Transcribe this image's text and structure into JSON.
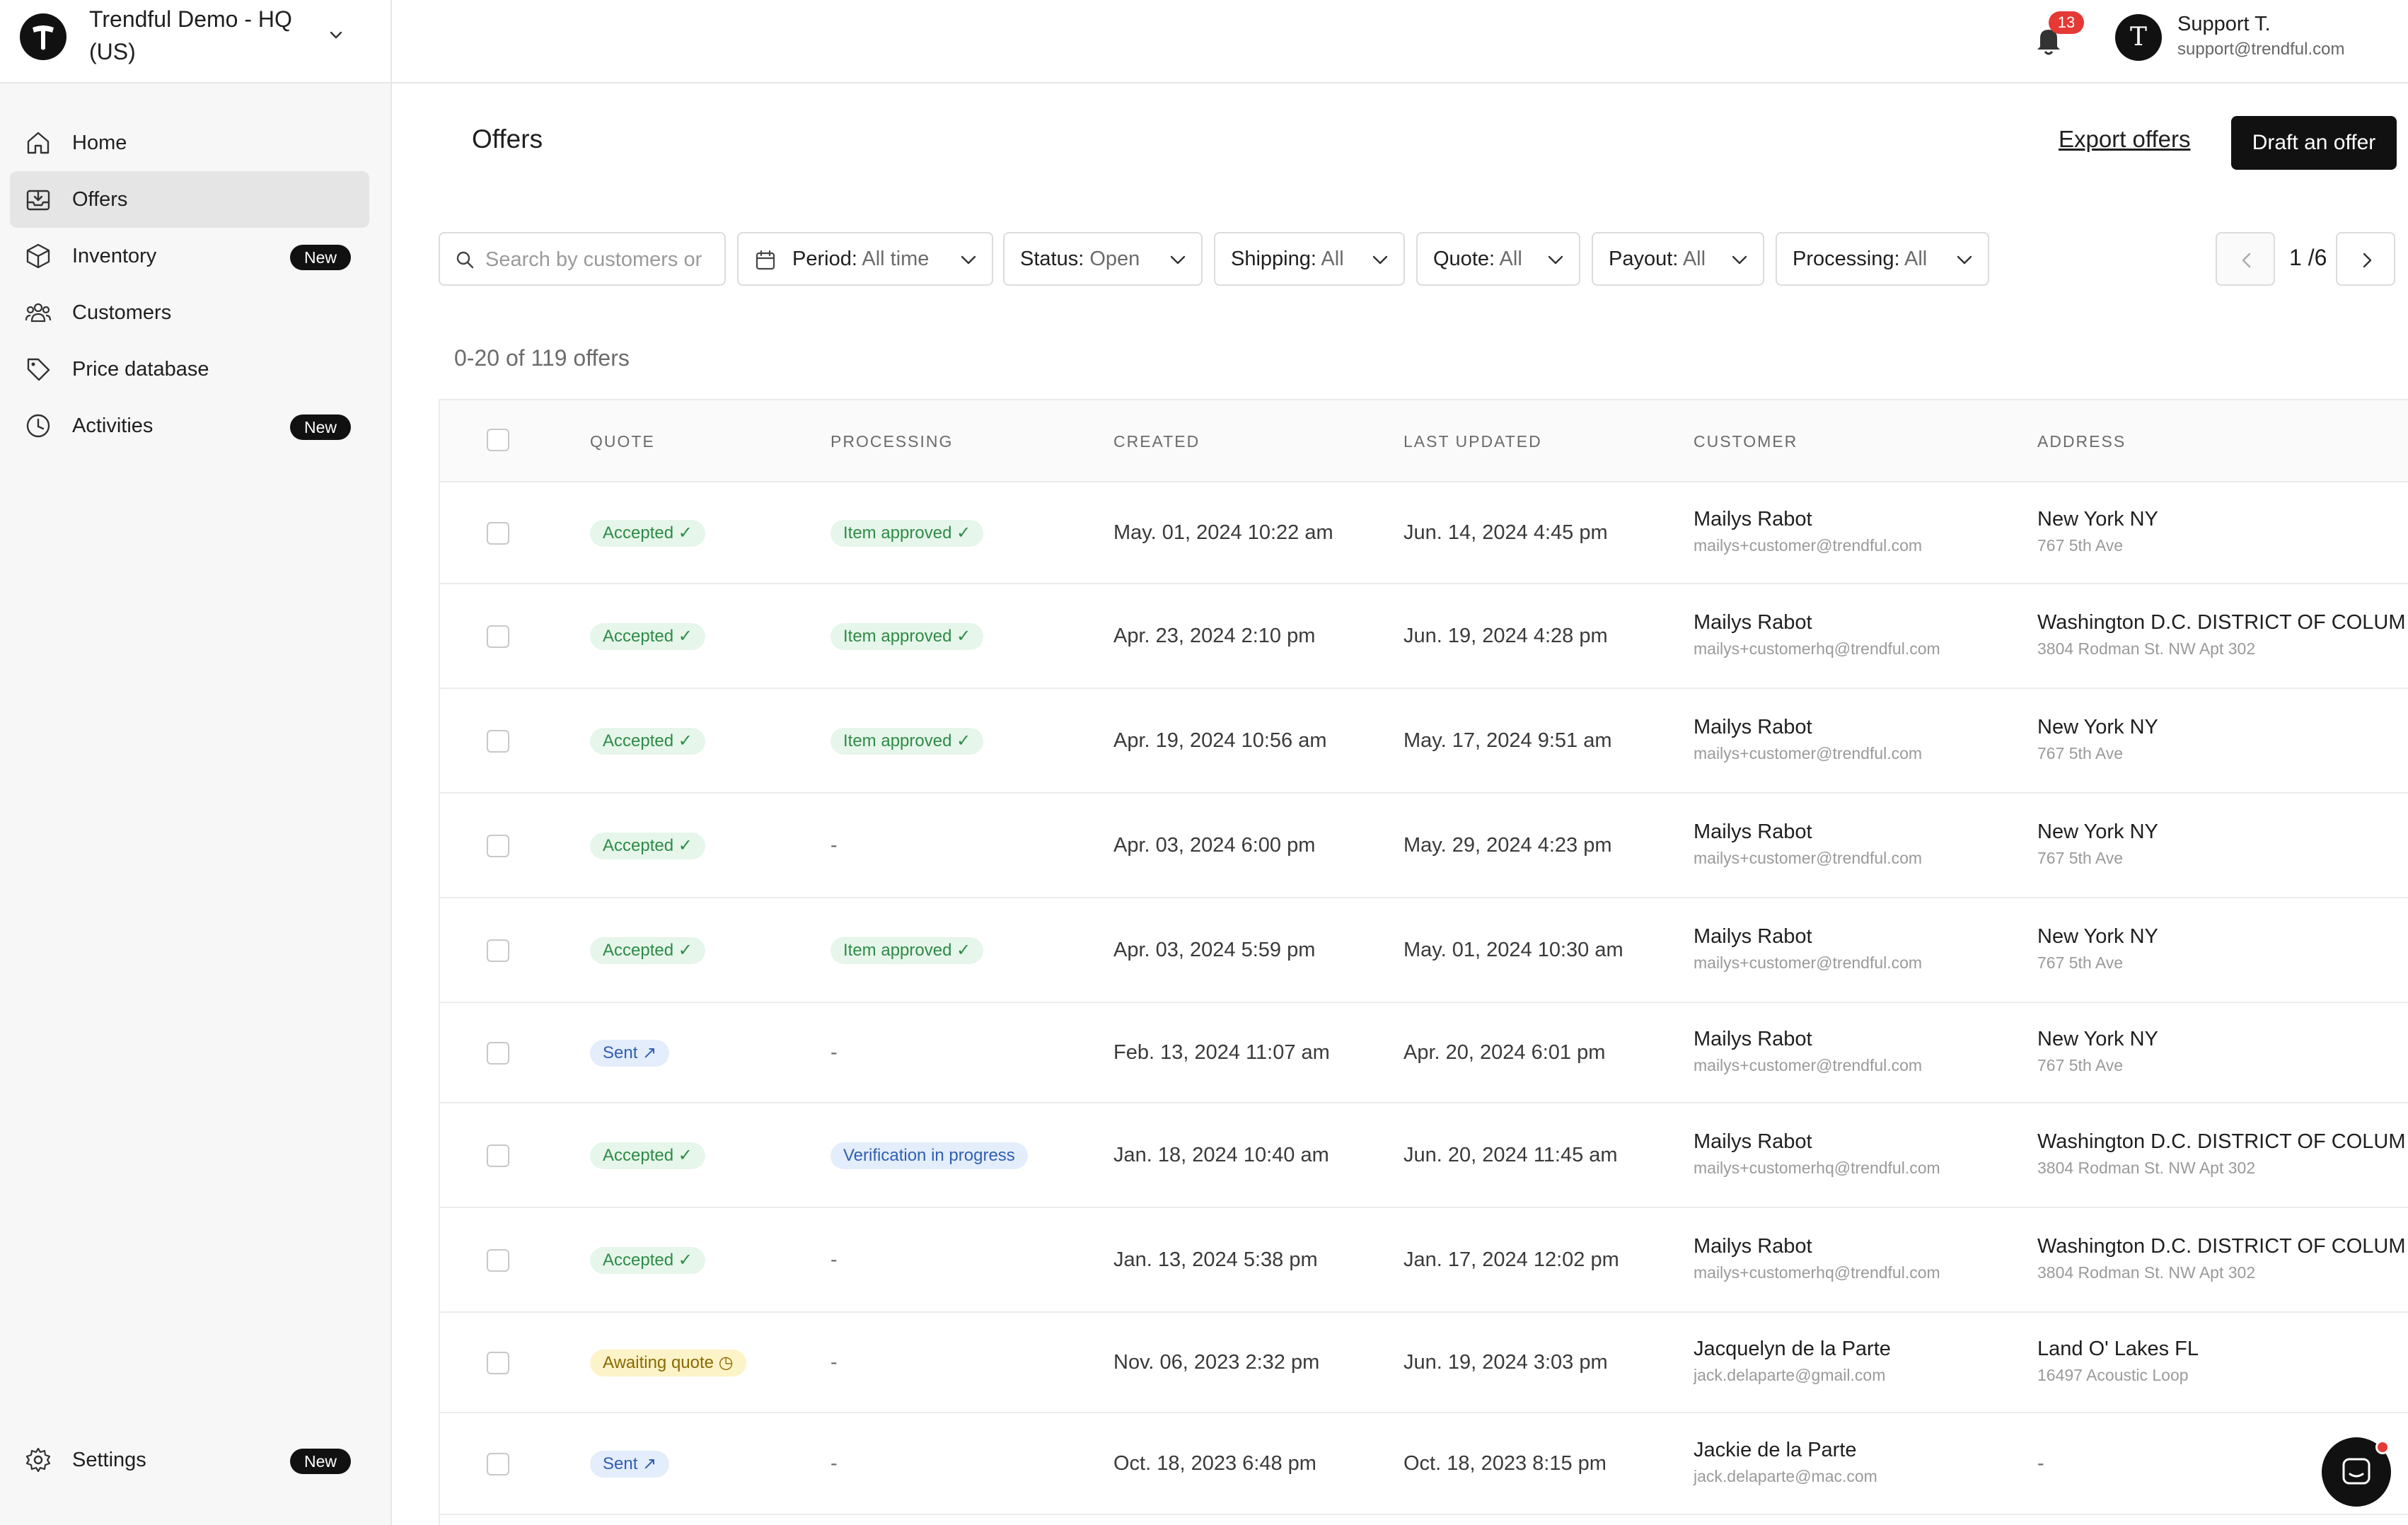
{
  "org": {
    "name": "Trendful Demo - HQ (US)"
  },
  "nav": {
    "items": [
      {
        "label": "Home",
        "icon": "home-icon",
        "badge": "",
        "active": false
      },
      {
        "label": "Offers",
        "icon": "inbox-icon",
        "badge": "",
        "active": true
      },
      {
        "label": "Inventory",
        "icon": "box-icon",
        "badge": "New",
        "active": false
      },
      {
        "label": "Customers",
        "icon": "users-icon",
        "badge": "",
        "active": false
      },
      {
        "label": "Price database",
        "icon": "tag-icon",
        "badge": "",
        "active": false
      },
      {
        "label": "Activities",
        "icon": "clock-icon",
        "badge": "New",
        "active": false
      }
    ],
    "settings": {
      "label": "Settings",
      "badge": "New",
      "icon": "gear-icon"
    }
  },
  "topbar": {
    "notifications_count": "13",
    "user": {
      "initial": "T",
      "name": "Support T.",
      "email": "support@trendful.com"
    }
  },
  "page": {
    "title": "Offers",
    "export_label": "Export offers",
    "draft_label": "Draft an offer"
  },
  "filters": {
    "search_placeholder": "Search by customers or",
    "period": {
      "label": "Period:",
      "value": "All time"
    },
    "status": {
      "label": "Status:",
      "value": "Open"
    },
    "shipping": {
      "label": "Shipping:",
      "value": "All"
    },
    "quote": {
      "label": "Quote:",
      "value": "All"
    },
    "payout": {
      "label": "Payout:",
      "value": "All"
    },
    "processing": {
      "label": "Processing:",
      "value": "All"
    }
  },
  "pager": {
    "text": "1 /6"
  },
  "count_text": "0-20 of 119 offers",
  "table": {
    "columns": [
      "QUOTE",
      "PROCESSING",
      "CREATED",
      "LAST UPDATED",
      "CUSTOMER",
      "ADDRESS"
    ],
    "rows": [
      {
        "quote": "Accepted ✓",
        "quote_color": "green",
        "processing": "Item approved ✓",
        "processing_color": "green",
        "created": "May. 01, 2024 10:22 am",
        "updated": "Jun. 14, 2024 4:45 pm",
        "customer_name": "Mailys Rabot",
        "customer_email": "mailys+customer@trendful.com",
        "address_city": "New York NY",
        "address_street": "767 5th Ave"
      },
      {
        "quote": "Accepted ✓",
        "quote_color": "green",
        "processing": "Item approved ✓",
        "processing_color": "green",
        "created": "Apr. 23, 2024 2:10 pm",
        "updated": "Jun. 19, 2024 4:28 pm",
        "customer_name": "Mailys Rabot",
        "customer_email": "mailys+customerhq@trendful.com",
        "address_city": "Washington D.C. DISTRICT OF COLUM",
        "address_street": "3804 Rodman St. NW Apt 302"
      },
      {
        "quote": "Accepted ✓",
        "quote_color": "green",
        "processing": "Item approved ✓",
        "processing_color": "green",
        "created": "Apr. 19, 2024 10:56 am",
        "updated": "May. 17, 2024 9:51 am",
        "customer_name": "Mailys Rabot",
        "customer_email": "mailys+customer@trendful.com",
        "address_city": "New York NY",
        "address_street": "767 5th Ave"
      },
      {
        "quote": "Accepted ✓",
        "quote_color": "green",
        "processing": "-",
        "processing_color": "",
        "created": "Apr. 03, 2024 6:00 pm",
        "updated": "May. 29, 2024 4:23 pm",
        "customer_name": "Mailys Rabot",
        "customer_email": "mailys+customer@trendful.com",
        "address_city": "New York NY",
        "address_street": "767 5th Ave"
      },
      {
        "quote": "Accepted ✓",
        "quote_color": "green",
        "processing": "Item approved ✓",
        "processing_color": "green",
        "created": "Apr. 03, 2024 5:59 pm",
        "updated": "May. 01, 2024 10:30 am",
        "customer_name": "Mailys Rabot",
        "customer_email": "mailys+customer@trendful.com",
        "address_city": "New York NY",
        "address_street": "767 5th Ave"
      },
      {
        "quote": "Sent ↗",
        "quote_color": "blue",
        "processing": "-",
        "processing_color": "",
        "created": "Feb. 13, 2024 11:07 am",
        "updated": "Apr. 20, 2024 6:01 pm",
        "customer_name": "Mailys Rabot",
        "customer_email": "mailys+customer@trendful.com",
        "address_city": "New York NY",
        "address_street": "767 5th Ave"
      },
      {
        "quote": "Accepted ✓",
        "quote_color": "green",
        "processing": "Verification in progress",
        "processing_color": "blue",
        "created": "Jan. 18, 2024 10:40 am",
        "updated": "Jun. 20, 2024 11:45 am",
        "customer_name": "Mailys Rabot",
        "customer_email": "mailys+customerhq@trendful.com",
        "address_city": "Washington D.C. DISTRICT OF COLUM",
        "address_street": "3804 Rodman St. NW Apt 302"
      },
      {
        "quote": "Accepted ✓",
        "quote_color": "green",
        "processing": "-",
        "processing_color": "",
        "created": "Jan. 13, 2024 5:38 pm",
        "updated": "Jan. 17, 2024 12:02 pm",
        "customer_name": "Mailys Rabot",
        "customer_email": "mailys+customerhq@trendful.com",
        "address_city": "Washington D.C. DISTRICT OF COLUM",
        "address_street": "3804 Rodman St. NW Apt 302"
      },
      {
        "quote": "Awaiting quote ◷",
        "quote_color": "yellow",
        "processing": "-",
        "processing_color": "",
        "created": "Nov. 06, 2023 2:32 pm",
        "updated": "Jun. 19, 2024 3:03 pm",
        "customer_name": "Jacquelyn de la Parte",
        "customer_email": "jack.delaparte@gmail.com",
        "address_city": "Land O' Lakes FL",
        "address_street": "16497 Acoustic Loop"
      },
      {
        "quote": "Sent ↗",
        "quote_color": "blue",
        "processing": "-",
        "processing_color": "",
        "created": "Oct. 18, 2023 6:48 pm",
        "updated": "Oct. 18, 2023 8:15 pm",
        "customer_name": "Jackie de la Parte",
        "customer_email": "jack.delaparte@mac.com",
        "address_city": "-",
        "address_street": ""
      }
    ]
  }
}
